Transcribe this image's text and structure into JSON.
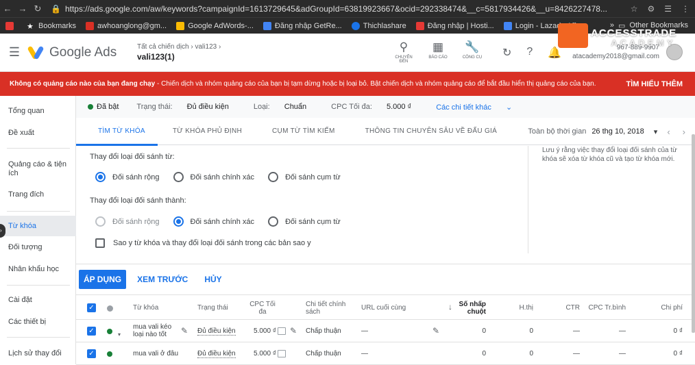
{
  "browser": {
    "url": "https://ads.google.com/aw/keywords?campaignId=1613729645&adGroupId=63819923667&ocid=292338474&__c=5817934426&__u=8426227478...",
    "bookmarks": [
      {
        "label": "",
        "color": "#e53935"
      },
      {
        "label": "Bookmarks",
        "color": "#ffffff"
      },
      {
        "label": "awhoanglong@gm...",
        "color": "#d93025"
      },
      {
        "label": "Google AdWords-...",
        "color": "#fbbc04"
      },
      {
        "label": "Đăng nhập GetRe...",
        "color": "#4285f4"
      },
      {
        "label": "Thichlashare",
        "color": "#1a73e8"
      },
      {
        "label": "Đăng nhập | Hosti...",
        "color": "#e53935"
      },
      {
        "label": "Login - Lazada Aff...",
        "color": "#4285f4"
      }
    ],
    "other_bookmarks": "Other Bookmarks"
  },
  "header": {
    "brand": "Google Ads",
    "crumb_parent": "Tất cả chiến dịch",
    "crumb_campaign": "vali123",
    "adgroup": "vali123(1)",
    "tools": [
      {
        "icon": "search-icon",
        "label": "CHUYỂN ĐẾN"
      },
      {
        "icon": "reports-icon",
        "label": "BÁO CÁO"
      },
      {
        "icon": "wrench-icon",
        "label": "CÔNG CỤ"
      }
    ],
    "account_id": "967-889-9907",
    "account_email": "atacademy2018@gmail.com",
    "watermark_top": "ACCESSTRADE",
    "watermark_bottom": "ACADEMY"
  },
  "banner": {
    "message_bold": "Không có quảng cáo nào của bạn đang chạy",
    "message_rest": " - Chiến dịch và nhóm quảng cáo của bạn bị tạm dừng hoặc bị loại bỏ. Bật chiến dịch và nhóm quảng cáo để bắt đầu hiển thị quảng cáo của bạn.",
    "action": "TÌM HIỂU THÊM"
  },
  "sidebar": {
    "items": [
      "Tổng quan",
      "Đề xuất",
      "Quảng cáo & tiện ích",
      "Trang đích",
      "Từ khóa",
      "Đối tượng",
      "Nhân khẩu học",
      "Cài đặt",
      "Các thiết bị",
      "Lịch sử thay đổi"
    ]
  },
  "status": {
    "state": "Đã bật",
    "status_label": "Trạng thái:",
    "status_value": "Đủ điều kiện",
    "type_label": "Loại:",
    "type_value": "Chuẩn",
    "cpc_label": "CPC Tối đa:",
    "cpc_value": "5.000 ₫",
    "details": "Các chi tiết khác"
  },
  "tabs": [
    "TÌM TỪ KHÓA",
    "TỪ KHÓA PHỦ ĐỊNH",
    "CỤM TỪ TÌM KIẾM",
    "THÔNG TIN CHUYÊN SÂU VỀ ĐẤU GIÁ"
  ],
  "daterange": {
    "label": "Toàn bộ thời gian",
    "value": "26 thg 10, 2018"
  },
  "panel": {
    "from_title": "Thay đổi loại đối sánh từ:",
    "to_title": "Thay đổi loại đối sánh thành:",
    "opt_broad": "Đối sánh rộng",
    "opt_exact": "Đối sánh chính xác",
    "opt_phrase": "Đối sánh cụm từ",
    "copy_label": "Sao y từ khóa và thay đổi loại đối sánh trong các bản sao y",
    "note": "Lưu ý rằng việc thay đổi loại đối sánh của từ khóa sẽ xóa từ khóa cũ và tạo từ khóa mới."
  },
  "actions": {
    "apply": "ÁP DỤNG",
    "preview": "XEM TRƯỚC",
    "cancel": "HỦY"
  },
  "table": {
    "headers": {
      "keyword": "Từ khóa",
      "status": "Trạng thái",
      "cpc": "CPC Tối đa",
      "policy": "Chi tiết chính sách",
      "url": "URL cuối cùng",
      "clicks": "Số nhấp chuột",
      "impr": "H.thị",
      "ctr": "CTR",
      "avgcpc": "CPC Tr.bình",
      "cost": "Chi phí"
    },
    "rows": [
      {
        "keyword": "mua vali kéo loại nào tốt",
        "status": "Đủ điều kiện",
        "cpc": "5.000 ₫",
        "policy": "Chấp thuận",
        "url": "—",
        "clicks": "0",
        "impr": "0",
        "ctr": "—",
        "avgcpc": "—",
        "cost": "0 ₫"
      },
      {
        "keyword": "mua vali ở đâu",
        "status": "Đủ điều kiện",
        "cpc": "5.000 ₫",
        "policy": "Chấp thuận",
        "url": "—",
        "clicks": "0",
        "impr": "0",
        "ctr": "—",
        "avgcpc": "—",
        "cost": "0 ₫"
      }
    ]
  }
}
